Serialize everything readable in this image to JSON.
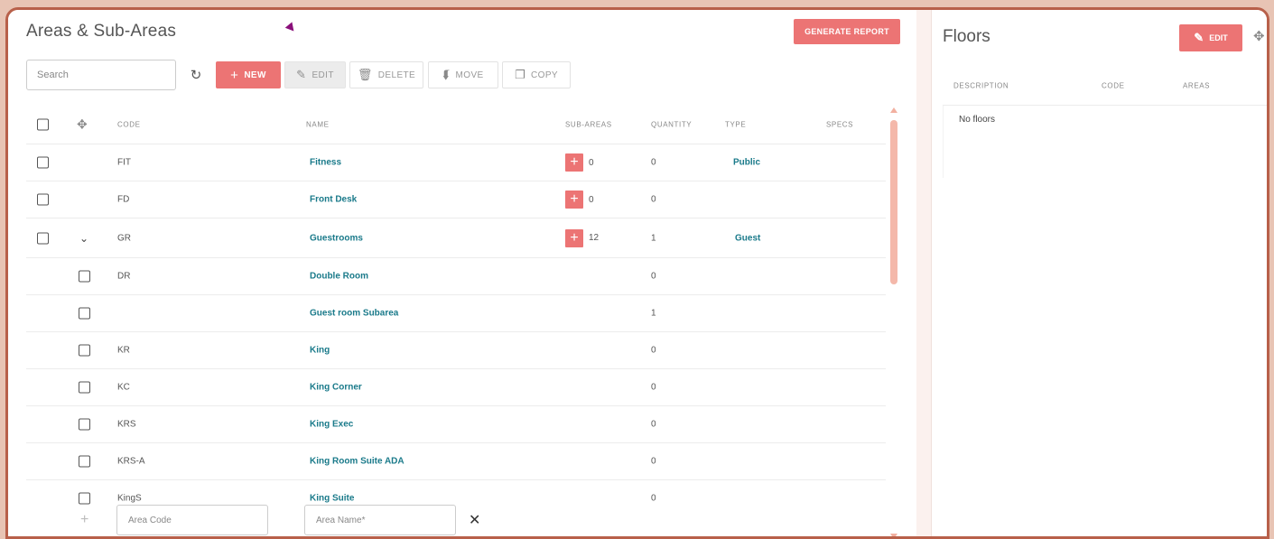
{
  "areas": {
    "title": "Areas & Sub-Areas",
    "generate_report_label": "GENERATE REPORT",
    "toolbar": {
      "search_placeholder": "Search",
      "new_label": "NEW",
      "edit_label": "EDIT",
      "delete_label": "DELETE",
      "move_label": "MOVE",
      "copy_label": "COPY"
    },
    "columns": {
      "code": "CODE",
      "name": "NAME",
      "sub_areas": "SUB-AREAS",
      "quantity": "QUANTITY",
      "type": "TYPE",
      "specs": "SPECS"
    },
    "rows": [
      {
        "code": "FIT",
        "name": "Fitness",
        "sub_areas": "0",
        "quantity": "0",
        "type": "Public"
      },
      {
        "code": "FD",
        "name": "Front Desk",
        "sub_areas": "0",
        "quantity": "0",
        "type": ""
      },
      {
        "code": "GR",
        "name": "Guestrooms",
        "sub_areas": "12",
        "quantity": "1",
        "type": "Guest"
      }
    ],
    "subrows": [
      {
        "code": "DR",
        "name": "Double Room",
        "quantity": "0"
      },
      {
        "code": "",
        "name": "Guest room Subarea",
        "quantity": "1"
      },
      {
        "code": "KR",
        "name": "King",
        "quantity": "0"
      },
      {
        "code": "KC",
        "name": "King Corner",
        "quantity": "0"
      },
      {
        "code": "KRS",
        "name": "King Exec",
        "quantity": "0"
      },
      {
        "code": "KRS-A",
        "name": "King Room Suite ADA",
        "quantity": "0"
      },
      {
        "code": "KingS",
        "name": "King Suite",
        "quantity": "0"
      }
    ],
    "add_row": {
      "code_placeholder": "Area Code",
      "name_placeholder": "Area Name*"
    }
  },
  "floors": {
    "title": "Floors",
    "edit_label": "EDIT",
    "columns": {
      "description": "DESCRIPTION",
      "code": "CODE",
      "areas": "AREAS"
    },
    "empty_text": "No floors"
  },
  "colors": {
    "accent": "#ec7474",
    "link": "#1a7a8a",
    "frame_border": "#b8604a",
    "page_bg": "#e8c4b4"
  }
}
